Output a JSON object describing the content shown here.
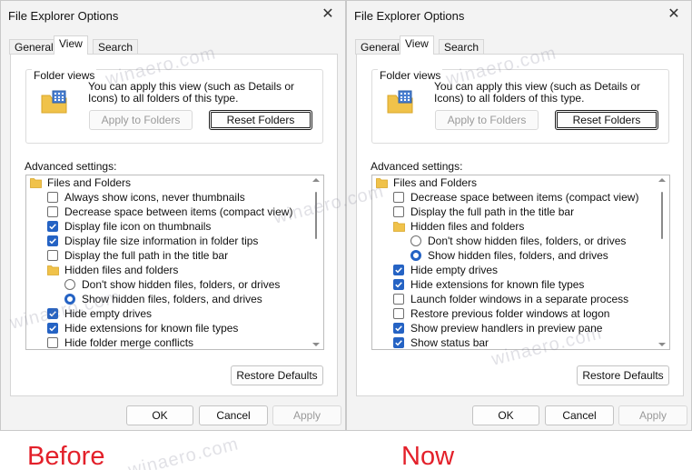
{
  "dialogs": [
    {
      "title": "File Explorer Options",
      "tabs": [
        "General",
        "View",
        "Search"
      ],
      "active_tab": "View",
      "folder_views": {
        "group_title": "Folder views",
        "description": "You can apply this view (such as Details or Icons) to all folders of this type.",
        "apply_button": "Apply to Folders",
        "reset_button": "Reset Folders"
      },
      "advanced_label": "Advanced settings:",
      "settings": [
        {
          "type": "folder",
          "indent": 0,
          "label": "Files and Folders"
        },
        {
          "type": "checkbox",
          "indent": 1,
          "checked": false,
          "label": "Always show icons, never thumbnails"
        },
        {
          "type": "checkbox",
          "indent": 1,
          "checked": false,
          "label": "Decrease space between items (compact view)"
        },
        {
          "type": "checkbox",
          "indent": 1,
          "checked": true,
          "label": "Display file icon on thumbnails"
        },
        {
          "type": "checkbox",
          "indent": 1,
          "checked": true,
          "label": "Display file size information in folder tips"
        },
        {
          "type": "checkbox",
          "indent": 1,
          "checked": false,
          "label": "Display the full path in the title bar"
        },
        {
          "type": "folder",
          "indent": 1,
          "label": "Hidden files and folders"
        },
        {
          "type": "radio",
          "indent": 2,
          "checked": false,
          "label": "Don't show hidden files, folders, or drives"
        },
        {
          "type": "radio",
          "indent": 2,
          "checked": true,
          "label": "Show hidden files, folders, and drives"
        },
        {
          "type": "checkbox",
          "indent": 1,
          "checked": true,
          "label": "Hide empty drives"
        },
        {
          "type": "checkbox",
          "indent": 1,
          "checked": true,
          "label": "Hide extensions for known file types"
        },
        {
          "type": "checkbox",
          "indent": 1,
          "checked": false,
          "label": "Hide folder merge conflicts"
        }
      ],
      "restore_button": "Restore Defaults",
      "ok_button": "OK",
      "cancel_button": "Cancel",
      "apply_button": "Apply"
    },
    {
      "title": "File Explorer Options",
      "tabs": [
        "General",
        "View",
        "Search"
      ],
      "active_tab": "View",
      "folder_views": {
        "group_title": "Folder views",
        "description": "You can apply this view (such as Details or Icons) to all folders of this type.",
        "apply_button": "Apply to Folders",
        "reset_button": "Reset Folders"
      },
      "advanced_label": "Advanced settings:",
      "settings": [
        {
          "type": "folder",
          "indent": 0,
          "label": "Files and Folders"
        },
        {
          "type": "checkbox",
          "indent": 1,
          "checked": false,
          "label": "Decrease space between items (compact view)"
        },
        {
          "type": "checkbox",
          "indent": 1,
          "checked": false,
          "label": "Display the full path in the title bar"
        },
        {
          "type": "folder",
          "indent": 1,
          "label": "Hidden files and folders"
        },
        {
          "type": "radio",
          "indent": 2,
          "checked": false,
          "label": "Don't show hidden files, folders, or drives"
        },
        {
          "type": "radio",
          "indent": 2,
          "checked": true,
          "label": "Show hidden files, folders, and drives"
        },
        {
          "type": "checkbox",
          "indent": 1,
          "checked": true,
          "label": "Hide empty drives"
        },
        {
          "type": "checkbox",
          "indent": 1,
          "checked": true,
          "label": "Hide extensions for known file types"
        },
        {
          "type": "checkbox",
          "indent": 1,
          "checked": false,
          "label": "Launch folder windows in a separate process"
        },
        {
          "type": "checkbox",
          "indent": 1,
          "checked": false,
          "label": "Restore previous folder windows at logon"
        },
        {
          "type": "checkbox",
          "indent": 1,
          "checked": true,
          "label": "Show preview handlers in preview pane"
        },
        {
          "type": "checkbox",
          "indent": 1,
          "checked": true,
          "label": "Show status bar"
        }
      ],
      "restore_button": "Restore Defaults",
      "ok_button": "OK",
      "cancel_button": "Cancel",
      "apply_button": "Apply"
    }
  ],
  "captions": [
    "Before",
    "Now"
  ],
  "watermark": "winaero.com",
  "colors": {
    "accent": "#2563c4",
    "caption": "#e3202a",
    "folder": "#f0c24a"
  }
}
